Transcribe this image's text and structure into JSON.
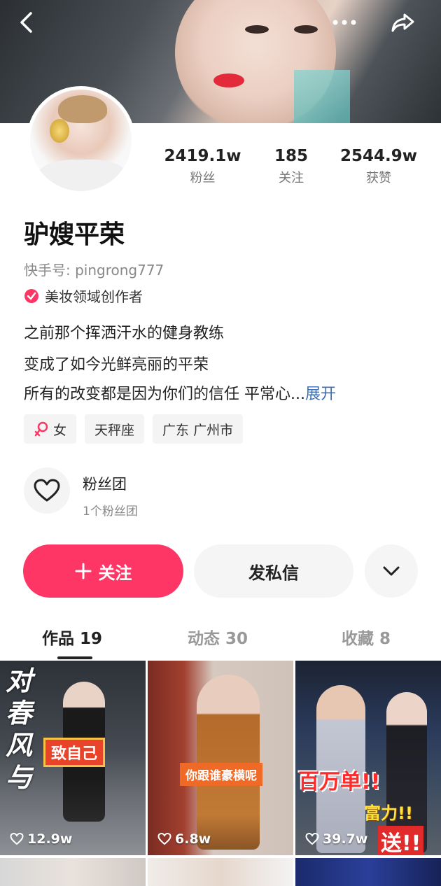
{
  "profile": {
    "name": "驴嫂平荣",
    "kuaishou_id": "快手号: pingrong777",
    "creator_badge": "美妆领域创作者",
    "stats": [
      {
        "value": "2419.1w",
        "label": "粉丝"
      },
      {
        "value": "185",
        "label": "关注"
      },
      {
        "value": "2544.9w",
        "label": "获赞"
      }
    ],
    "bio": [
      "之前那个挥洒汗水的健身教练",
      "变成了如今光鲜亮丽的平荣",
      "所有的改变都是因为你们的信任 平常心..."
    ],
    "bio_expand": "展开",
    "tags": [
      {
        "icon": "female-icon",
        "label": "女"
      },
      {
        "label": "天秤座"
      },
      {
        "label": "广东 广州市"
      }
    ],
    "fan_club": {
      "title": "粉丝团",
      "subtitle": "1个粉丝团"
    }
  },
  "actions": {
    "follow": "关注",
    "message": "发私信"
  },
  "tabs": [
    {
      "label": "作品 19",
      "active": true
    },
    {
      "label": "动态 30",
      "active": false
    },
    {
      "label": "收藏 8",
      "active": false
    }
  ],
  "videos": [
    {
      "likes": "12.9w",
      "caption": "致自己",
      "overlay": "对春风与"
    },
    {
      "likes": "6.8w",
      "caption": "你跟谁豪横呢"
    },
    {
      "likes": "39.7w",
      "caption": "百万单!!",
      "caption2": "富力!!",
      "caption3": "送!!"
    }
  ],
  "colors": {
    "accent": "#fe3666",
    "link": "#3c6fb6"
  }
}
